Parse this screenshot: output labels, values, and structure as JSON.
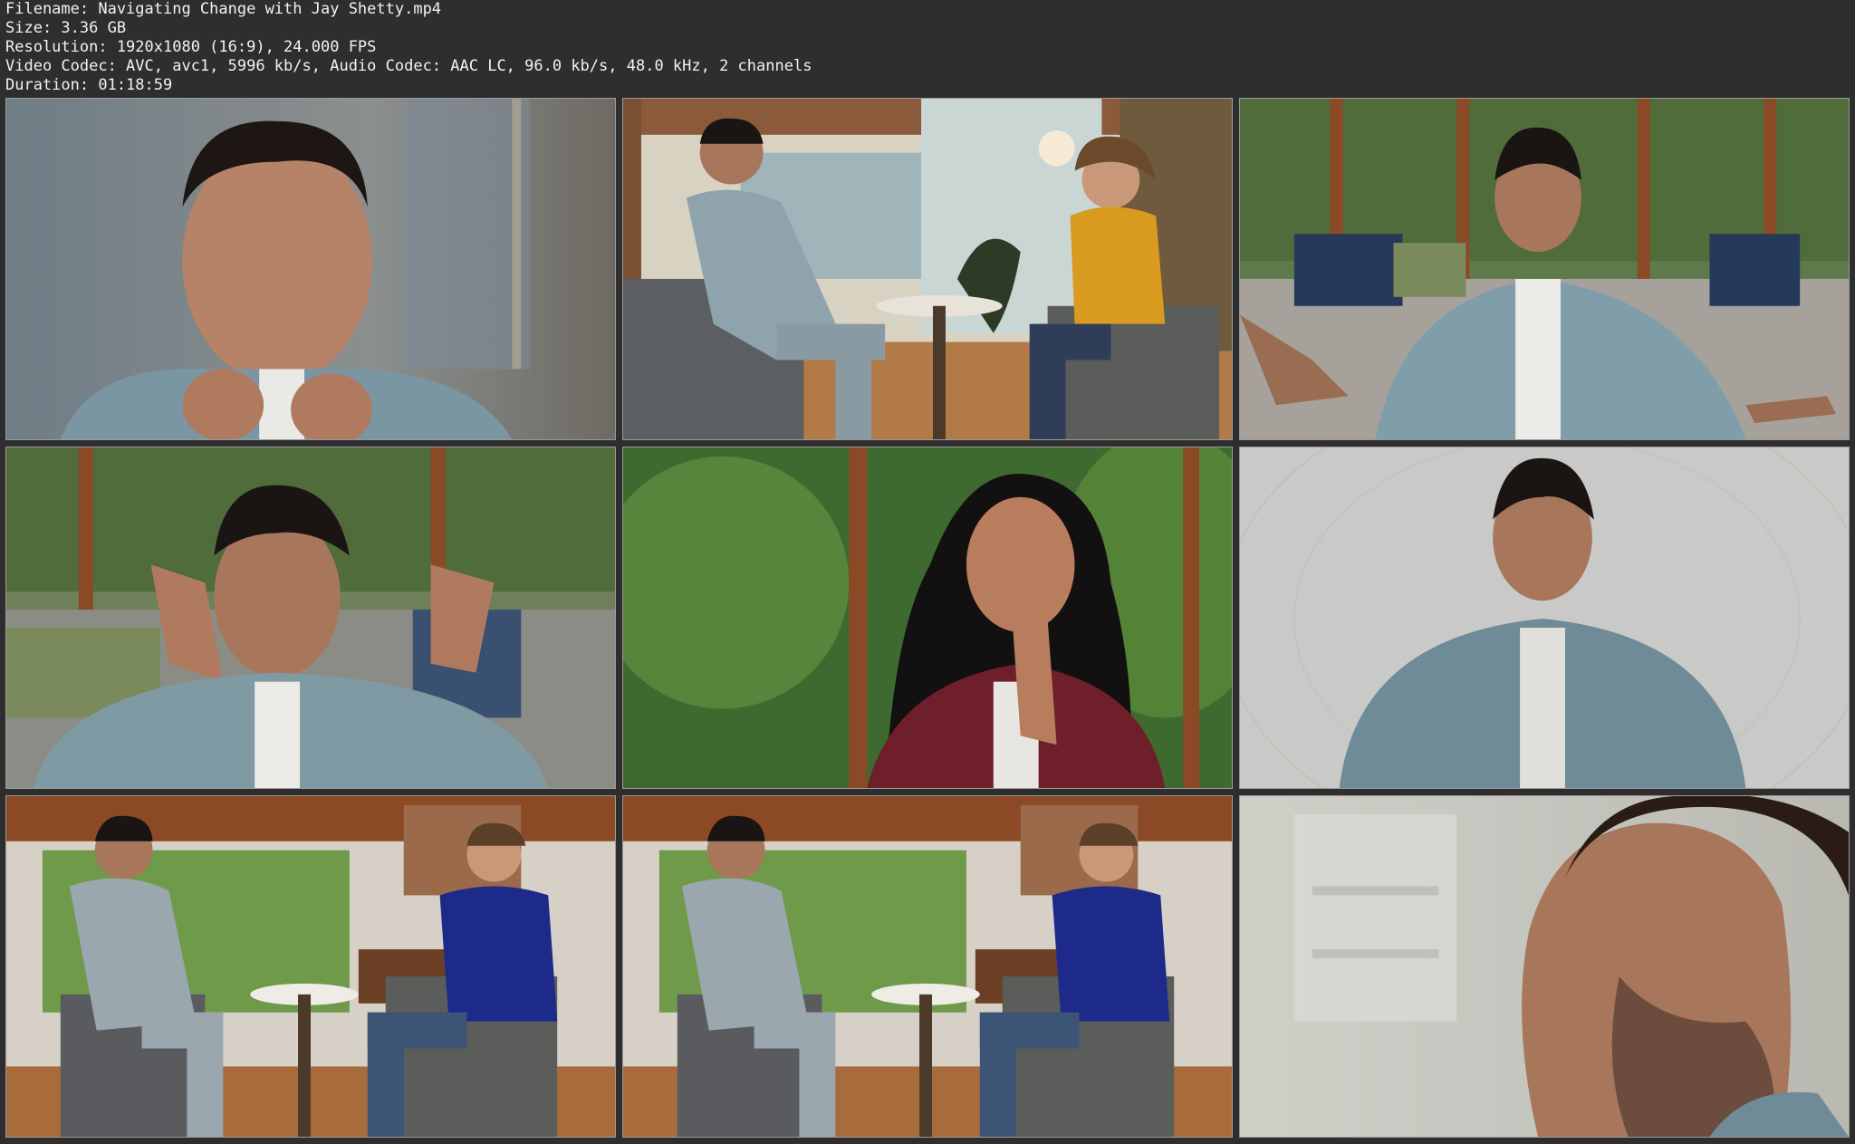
{
  "metadata": {
    "filename": "Filename: Navigating Change with Jay Shetty.mp4",
    "size": "Size: 3.36 GB",
    "resolution": "Resolution: 1920x1080 (16:9), 24.000 FPS",
    "codecs": "Video Codec: AVC, avc1, 5996 kb/s, Audio Codec: AAC LC, 96.0 kb/s, 48.0 kHz, 2 channels",
    "duration": "Duration: 01:18:59"
  },
  "colors": {
    "background": "#2e2e2e",
    "text": "#f2f2f2",
    "thumb_border": "#9a9a9a"
  }
}
